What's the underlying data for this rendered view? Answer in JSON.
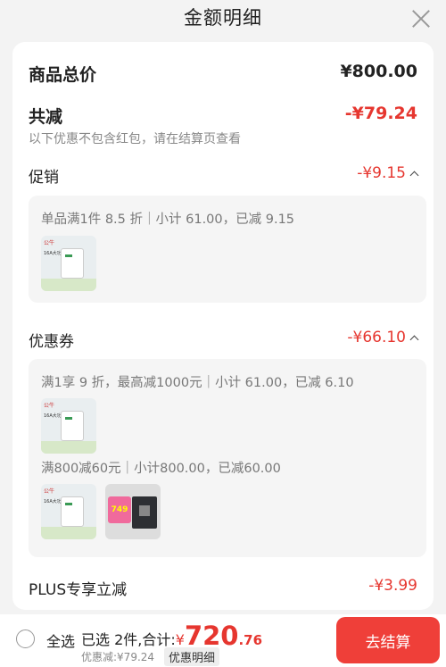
{
  "header": {
    "title": "金额明细"
  },
  "summary": {
    "total_label": "商品总价",
    "total_value": "¥800.00",
    "reduction_label": "共减",
    "reduction_value": "-¥79.24",
    "reduction_note": "以下优惠不包含红包，请在结算页查看"
  },
  "promotion": {
    "label": "促销",
    "value": "-¥9.15",
    "detail": "单品满1件 8.5 折｜小计 61.00，已减 9.15",
    "thumb_brand": "公牛",
    "thumb_caption": "16A大功率插座"
  },
  "coupon": {
    "label": "优惠券",
    "value": "-¥66.10",
    "detail_1": "满1享 9 折，最高减1000元｜小计 61.00，已减 6.10",
    "detail_2": "满800减60元｜小计800.00，已减60.00",
    "thumb_brand": "公牛",
    "thumb_caption": "16A大功率插座",
    "thumb2_badge": "749"
  },
  "plus": {
    "label": "PLUS专享立减",
    "value": "-¥3.99"
  },
  "footer": {
    "select_all": "全选",
    "selected_text": "已选 2件,合计:",
    "currency": "¥",
    "amount_int": "720",
    "amount_dec": ".76",
    "discount_text": "优惠减:¥79.24",
    "detail_button": "优惠明细",
    "checkout_button": "去结算"
  },
  "colors": {
    "accent": "#e6362f",
    "checkout": "#ef3f39"
  }
}
